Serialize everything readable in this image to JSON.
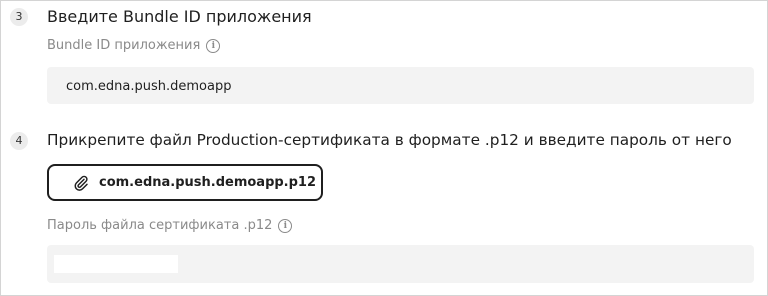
{
  "step3": {
    "number": "3",
    "title": "Введите Bundle ID приложения",
    "field_label": "Bundle ID приложения",
    "field_value": "com.edna.push.demoapp"
  },
  "step4": {
    "number": "4",
    "title": "Прикрепите файл Production-сертификата в формате .p12 и введите пароль от него",
    "file_name": "com.edna.push.demoapp.p12",
    "password_label": "Пароль файла сертификата .p12"
  },
  "icons": {
    "info": "info-icon",
    "attach": "paperclip-icon"
  }
}
